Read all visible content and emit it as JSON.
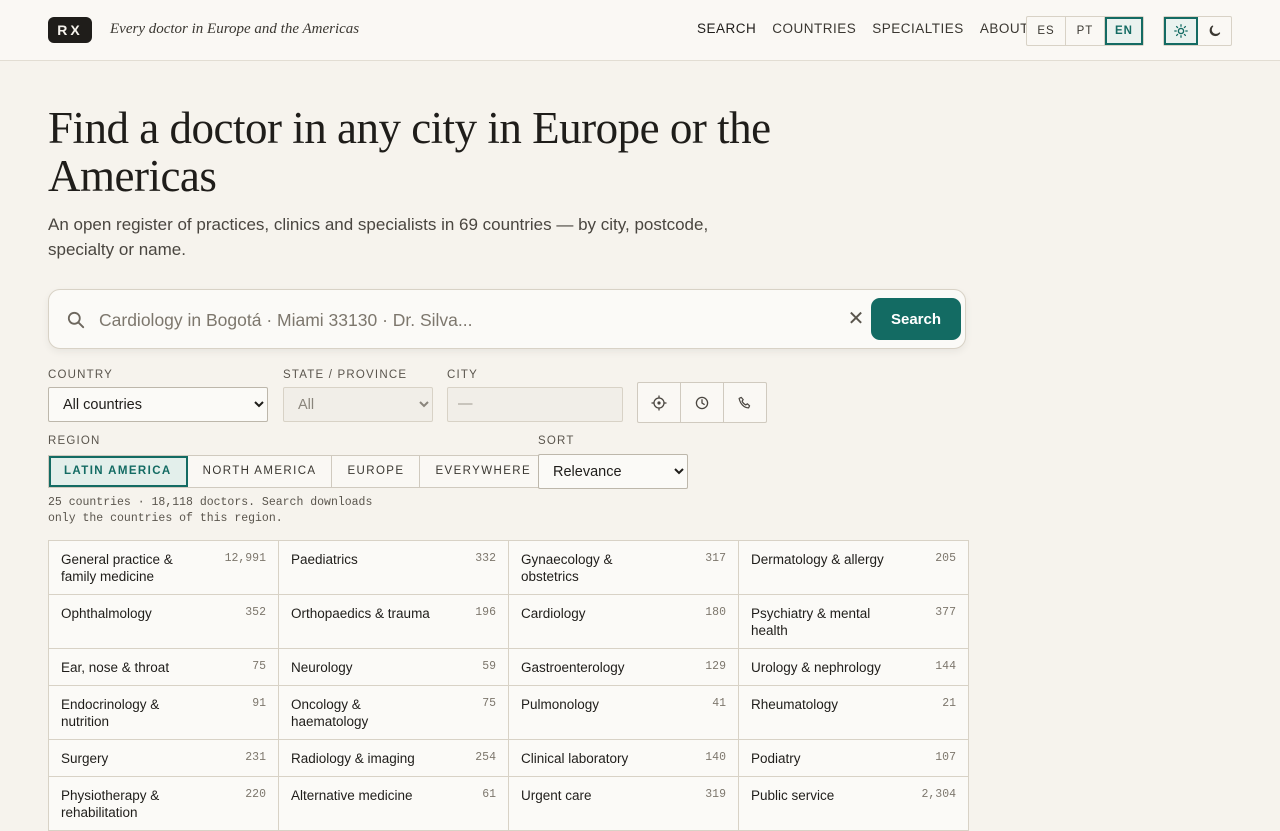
{
  "header": {
    "logo": "RX",
    "tagline": "Every doctor in Europe and the Americas",
    "nav": [
      "SEARCH",
      "COUNTRIES",
      "SPECIALTIES",
      "ABOUT"
    ],
    "languages": [
      "ES",
      "PT",
      "EN"
    ],
    "active_language": "EN"
  },
  "hero": {
    "title": "Find a doctor in any city in Europe or the Americas",
    "subtitle": "An open register of practices, clinics and specialists in 69 countries — by city, postcode, specialty or name."
  },
  "search": {
    "placeholder": "Cardiology in Bogotá · Miami 33130 · Dr. Silva...",
    "clear_label": "✕",
    "button_label": "Search"
  },
  "filters": {
    "country_label": "COUNTRY",
    "country_value": "All countries",
    "state_label": "STATE / PROVINCE",
    "state_value": "All",
    "city_label": "CITY",
    "city_value": "—",
    "region_label": "REGION",
    "regions": [
      "LATIN AMERICA",
      "NORTH AMERICA",
      "EUROPE",
      "EVERYWHERE"
    ],
    "active_region": "LATIN AMERICA",
    "sort_label": "SORT",
    "sort_value": "Relevance",
    "meta_line1": "25 countries · 18,118 doctors. Search downloads",
    "meta_line2": "only the countries of this region."
  },
  "specialties": [
    {
      "name": "General practice & family medicine",
      "count": "12,991"
    },
    {
      "name": "Paediatrics",
      "count": "332"
    },
    {
      "name": "Gynaecology & obstetrics",
      "count": "317"
    },
    {
      "name": "Dermatology & allergy",
      "count": "205"
    },
    {
      "name": "Ophthalmology",
      "count": "352"
    },
    {
      "name": "Orthopaedics & trauma",
      "count": "196"
    },
    {
      "name": "Cardiology",
      "count": "180"
    },
    {
      "name": "Psychiatry & mental health",
      "count": "377"
    },
    {
      "name": "Ear, nose & throat",
      "count": "75"
    },
    {
      "name": "Neurology",
      "count": "59"
    },
    {
      "name": "Gastroenterology",
      "count": "129"
    },
    {
      "name": "Urology & nephrology",
      "count": "144"
    },
    {
      "name": "Endocrinology & nutrition",
      "count": "91"
    },
    {
      "name": "Oncology & haematology",
      "count": "75"
    },
    {
      "name": "Pulmonology",
      "count": "41"
    },
    {
      "name": "Rheumatology",
      "count": "21"
    },
    {
      "name": "Surgery",
      "count": "231"
    },
    {
      "name": "Radiology & imaging",
      "count": "254"
    },
    {
      "name": "Clinical laboratory",
      "count": "140"
    },
    {
      "name": "Podiatry",
      "count": "107"
    },
    {
      "name": "Physiotherapy & rehabilitation",
      "count": "220"
    },
    {
      "name": "Alternative medicine",
      "count": "61"
    },
    {
      "name": "Urgent care",
      "count": "319"
    },
    {
      "name": "Public service",
      "count": "2,304"
    }
  ],
  "colors": {
    "accent": "#136b63",
    "background": "#f6f3ed",
    "text": "#1f1d1a"
  }
}
